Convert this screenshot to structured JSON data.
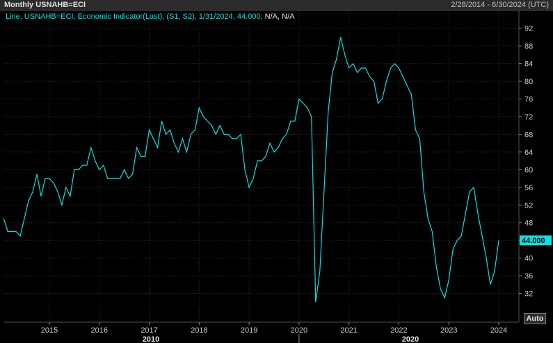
{
  "header": {
    "title": "Monthly USNAHB=ECI",
    "date_range": "2/28/2014 - 6/30/2024 (UTC)"
  },
  "legend": {
    "text": "Line, USNAHB=ECI, Economic Indicator(Last), (S1, S2), 1/31/2024, 44.000,",
    "na": "N/A, N/A"
  },
  "last_value_label": "44.000",
  "auto_button": "Auto",
  "colors": {
    "background": "#000000",
    "line": "#00e5e5",
    "last_tag": "#00e5e5",
    "grid": "#2a2a2a"
  },
  "chart_data": {
    "type": "line",
    "title": "Monthly USNAHB=ECI",
    "xlabel": "",
    "ylabel": "",
    "y_ticks": [
      32,
      36,
      40,
      44,
      48,
      52,
      56,
      60,
      64,
      68,
      72,
      76,
      80,
      84,
      88,
      92
    ],
    "ylim": [
      28,
      94
    ],
    "x_ticks": [
      "2015",
      "2016",
      "2017",
      "2018",
      "2019",
      "2020",
      "2021",
      "2022",
      "2023",
      "2024"
    ],
    "x_major": [
      "2010",
      "2020"
    ],
    "xlim": [
      "2014-02",
      "2024-06"
    ],
    "grid": true,
    "series": [
      {
        "name": "USNAHB=ECI",
        "x": [
          "2014-02",
          "2014-03",
          "2014-04",
          "2014-05",
          "2014-06",
          "2014-07",
          "2014-08",
          "2014-09",
          "2014-10",
          "2014-11",
          "2014-12",
          "2015-01",
          "2015-02",
          "2015-03",
          "2015-04",
          "2015-05",
          "2015-06",
          "2015-07",
          "2015-08",
          "2015-09",
          "2015-10",
          "2015-11",
          "2015-12",
          "2016-01",
          "2016-02",
          "2016-03",
          "2016-04",
          "2016-05",
          "2016-06",
          "2016-07",
          "2016-08",
          "2016-09",
          "2016-10",
          "2016-11",
          "2016-12",
          "2017-01",
          "2017-02",
          "2017-03",
          "2017-04",
          "2017-05",
          "2017-06",
          "2017-07",
          "2017-08",
          "2017-09",
          "2017-10",
          "2017-11",
          "2017-12",
          "2018-01",
          "2018-02",
          "2018-03",
          "2018-04",
          "2018-05",
          "2018-06",
          "2018-07",
          "2018-08",
          "2018-09",
          "2018-10",
          "2018-11",
          "2018-12",
          "2019-01",
          "2019-02",
          "2019-03",
          "2019-04",
          "2019-05",
          "2019-06",
          "2019-07",
          "2019-08",
          "2019-09",
          "2019-10",
          "2019-11",
          "2019-12",
          "2020-01",
          "2020-02",
          "2020-03",
          "2020-04",
          "2020-05",
          "2020-06",
          "2020-07",
          "2020-08",
          "2020-09",
          "2020-10",
          "2020-11",
          "2020-12",
          "2021-01",
          "2021-02",
          "2021-03",
          "2021-04",
          "2021-05",
          "2021-06",
          "2021-07",
          "2021-08",
          "2021-09",
          "2021-10",
          "2021-11",
          "2021-12",
          "2022-01",
          "2022-02",
          "2022-03",
          "2022-04",
          "2022-05",
          "2022-06",
          "2022-07",
          "2022-08",
          "2022-09",
          "2022-10",
          "2022-11",
          "2022-12",
          "2023-01",
          "2023-02",
          "2023-03",
          "2023-04",
          "2023-05",
          "2023-06",
          "2023-07",
          "2023-08",
          "2023-09",
          "2023-10",
          "2023-11",
          "2023-12",
          "2024-01"
        ],
        "values": [
          49,
          46,
          46,
          46,
          45,
          49,
          53,
          55,
          59,
          54,
          58,
          58,
          57,
          55,
          52,
          56,
          54,
          60,
          60,
          61,
          61,
          65,
          62,
          60,
          61,
          58,
          58,
          58,
          58,
          60,
          58,
          59,
          65,
          63,
          63,
          69,
          67,
          65,
          71,
          68,
          69,
          66,
          64,
          67,
          64,
          68,
          69,
          74,
          72,
          71,
          70,
          68,
          70,
          68,
          68,
          67,
          67,
          68,
          60,
          56,
          58,
          62,
          62,
          63,
          66,
          64,
          65,
          67,
          68,
          71,
          71,
          76,
          75,
          74,
          72,
          30,
          37,
          55,
          73,
          82,
          85,
          90,
          86,
          83,
          84,
          82,
          83,
          83,
          81,
          80,
          75,
          76,
          80,
          83,
          84,
          83,
          81,
          79,
          77,
          69,
          67,
          55,
          49,
          46,
          38,
          33,
          31,
          35,
          42,
          44,
          45,
          50,
          55,
          56,
          50,
          45,
          40,
          34,
          37,
          44
        ]
      }
    ]
  }
}
